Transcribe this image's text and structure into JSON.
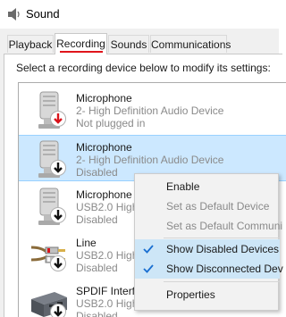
{
  "window": {
    "title": "Sound"
  },
  "tabs": [
    {
      "label": "Playback",
      "active": false
    },
    {
      "label": "Recording",
      "active": true
    },
    {
      "label": "Sounds",
      "active": false
    },
    {
      "label": "Communications",
      "active": false
    }
  ],
  "instruction": "Select a recording device below to modify its settings:",
  "devices": [
    {
      "name": "Microphone",
      "sub": "2- High Definition Audio Device",
      "status": "Not plugged in",
      "icon": "microphone-icon",
      "badge": "red-down-arrow",
      "selected": false
    },
    {
      "name": "Microphone",
      "sub": "2- High Definition Audio Device",
      "status": "Disabled",
      "icon": "microphone-icon",
      "badge": "black-down-arrow",
      "selected": true
    },
    {
      "name": "Microphone",
      "sub": "USB2.0 High",
      "status": "Disabled",
      "icon": "microphone-icon",
      "badge": "black-down-arrow",
      "selected": false
    },
    {
      "name": "Line",
      "sub": "USB2.0 High",
      "status": "Disabled",
      "icon": "rca-cable-icon",
      "badge": "black-down-arrow",
      "selected": false
    },
    {
      "name": "SPDIF Interfa",
      "sub": "USB2.0 High",
      "status": "Disabled",
      "icon": "spdif-device-icon",
      "badge": "black-down-arrow",
      "selected": false
    }
  ],
  "context_menu": {
    "items": [
      {
        "label": "Enable",
        "enabled": true,
        "checked": false
      },
      {
        "label": "Set as Default Device",
        "enabled": false,
        "checked": false
      },
      {
        "label": "Set as Default Communi",
        "enabled": false,
        "checked": false
      },
      {
        "label": "Show Disabled Devices",
        "enabled": true,
        "checked": true
      },
      {
        "label": "Show Disconnected Dev",
        "enabled": true,
        "checked": true
      },
      {
        "label": "Properties",
        "enabled": true,
        "checked": false
      }
    ]
  },
  "colors": {
    "accent_red": "#e0151b",
    "selection": "#cce8ff",
    "check_blue": "#1a6fd1"
  }
}
